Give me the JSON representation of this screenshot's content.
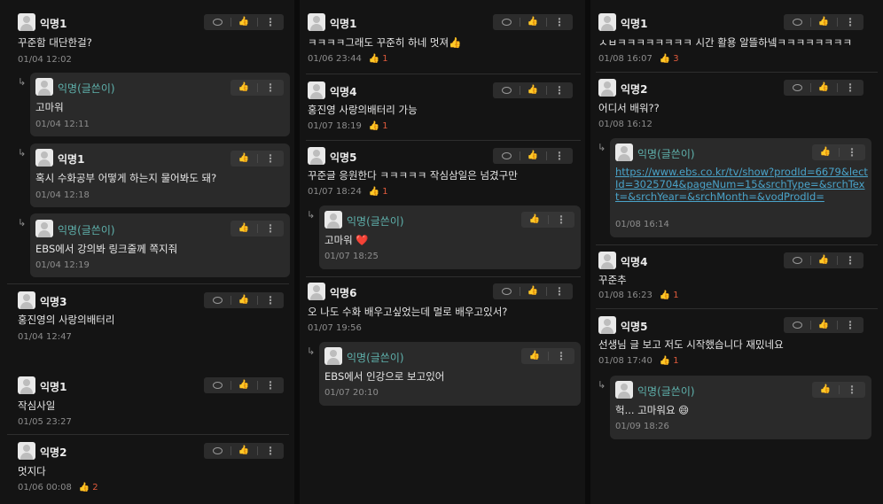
{
  "reply_arrow": "↳",
  "icons": {
    "reply": "speech-bubble-icon",
    "like": "thumbs-up-icon",
    "more": "more-vertical-icon",
    "thumb_glyph": "👍",
    "more_glyph": "⋮"
  },
  "colors": {
    "background": "#141414",
    "author": "#5fb2ad",
    "likes": "#e05a3c",
    "link": "#4aa3c9"
  },
  "col1": [
    {
      "name": "익명1",
      "text": "꾸준함 대단한걸?",
      "time": "01/04 12:02",
      "likes": ""
    },
    {
      "name": "익명(글쓴이)",
      "text": "고마워",
      "time": "01/04 12:11",
      "likes": ""
    },
    {
      "name": "익명1",
      "text": "혹시 수화공부 어떻게 하는지 물어봐도 돼?",
      "time": "01/04 12:18",
      "likes": ""
    },
    {
      "name": "익명(글쓴이)",
      "text": "EBS에서 강의봐 링크줄께 쪽지줘",
      "time": "01/04 12:19",
      "likes": ""
    },
    {
      "name": "익명3",
      "text": "홍진영의 사랑의배터리",
      "time": "01/04 12:47",
      "likes": ""
    },
    {
      "name": "익명1",
      "text": "작심사일",
      "time": "01/05 23:27",
      "likes": ""
    },
    {
      "name": "익명2",
      "text": "멋지다",
      "time": "01/06 00:08",
      "likes": "2"
    }
  ],
  "col2": [
    {
      "name": "익명1",
      "text": "ㅋㅋㅋㅋ그래도 꾸준히 하네 멋져👍",
      "time": "01/06 23:44",
      "likes": "1"
    },
    {
      "name": "익명4",
      "text": "홍진영 사랑의배터리 가능",
      "time": "01/07 18:19",
      "likes": "1"
    },
    {
      "name": "익명5",
      "text": "꾸준글 응원한다 ㅋㅋㅋㅋㅋ 작심삼일은 넘겼구만",
      "time": "01/07 18:24",
      "likes": "1"
    },
    {
      "name": "익명(글쓴이)",
      "text": "고마워 ❤️",
      "time": "01/07 18:25",
      "likes": ""
    },
    {
      "name": "익명6",
      "text": "오 나도 수화 배우고싶었는데 멀로 배우고있서?",
      "time": "01/07 19:56",
      "likes": ""
    },
    {
      "name": "익명(글쓴이)",
      "text": "EBS에서 인강으로 보고있어",
      "time": "01/07 20:10",
      "likes": ""
    }
  ],
  "col3": [
    {
      "name": "익명1",
      "text": "ㅅㅂㅋㅋㅋㅋㅋㅋㅋㅋ 시간 활용 알뜰하넼ㅋㅋㅋㅋㅋㅋㅋㅋ",
      "time": "01/08 16:07",
      "likes": "3"
    },
    {
      "name": "익명2",
      "text": "어디서 배워??",
      "time": "01/08 16:12",
      "likes": ""
    },
    {
      "name": "익명(글쓴이)",
      "text": "https://www.ebs.co.kr/tv/show?prodId=6679&lectId=3025704&pageNum=15&srchType=&srchText=&srchYear=&srchMonth=&vodProdId=",
      "time": "01/08 16:14",
      "likes": ""
    },
    {
      "name": "익명4",
      "text": "꾸준추",
      "time": "01/08 16:23",
      "likes": "1"
    },
    {
      "name": "익명5",
      "text": "선생님 글 보고 저도 시작했습니다 재밌네요",
      "time": "01/08 17:40",
      "likes": "1"
    },
    {
      "name": "익명(글쓴이)",
      "text": "헉... 고마워요 😄",
      "time": "01/09 18:26",
      "likes": ""
    }
  ]
}
